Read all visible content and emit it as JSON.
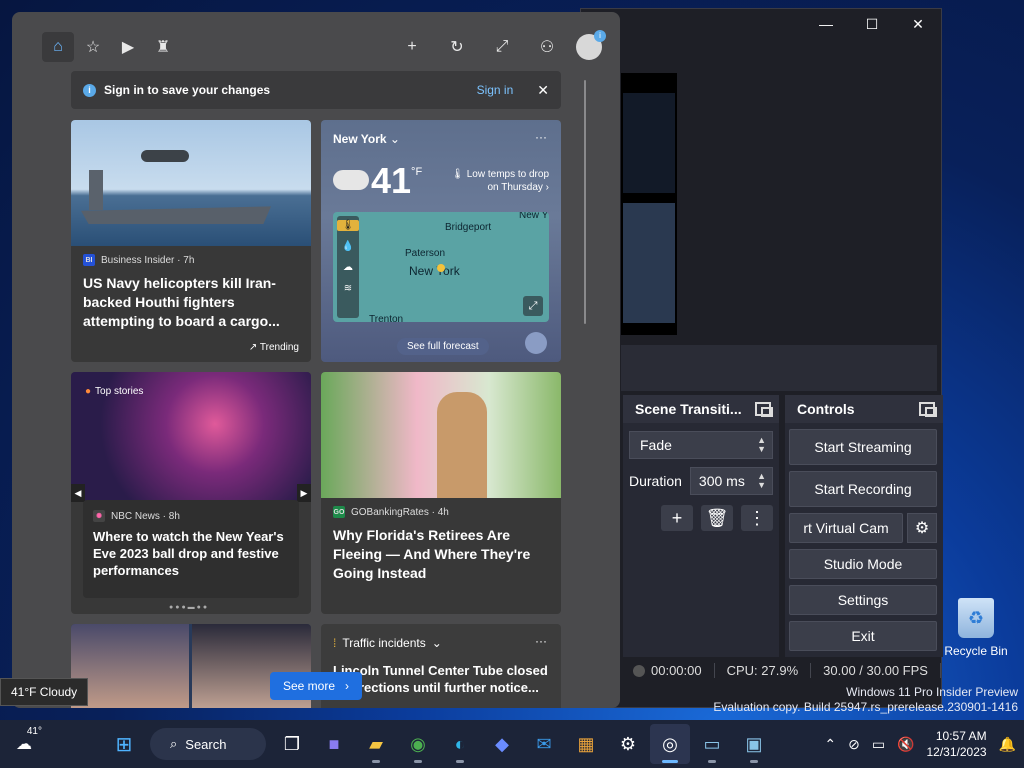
{
  "obs": {
    "window_controls": {
      "minimize": "—",
      "maximize": "☐",
      "close": "✕"
    },
    "scene_transitions": {
      "title": "Scene Transiti...",
      "transition": "Fade",
      "duration_label": "Duration",
      "duration_value": "300 ms",
      "add": "+",
      "remove": "🗑",
      "more": "⋮"
    },
    "controls": {
      "title": "Controls",
      "start_streaming": "Start Streaming",
      "start_recording": "Start Recording",
      "virtual_cam": "rt Virtual Cam",
      "studio_mode": "Studio Mode",
      "settings": "Settings",
      "exit": "Exit"
    },
    "status": {
      "rec_time": "00:00:00",
      "cpu": "CPU: 27.9%",
      "fps": "30.00 / 30.00 FPS"
    }
  },
  "watermark": {
    "line1": "Windows 11 Pro Insider Preview",
    "line2": "Evaluation copy. Build 25947.rs_prerelease.230901-1416"
  },
  "desktop": {
    "recycle_bin": "Recycle Bin"
  },
  "widgets": {
    "signin_bar": {
      "message": "Sign in to save your changes",
      "link": "Sign in"
    },
    "cards": {
      "navy": {
        "source": "Business Insider · 7h",
        "source_logo": "BI",
        "headline": "US Navy helicopters kill Iran-backed Houthi fighters attempting to board a cargo...",
        "trending": "Trending"
      },
      "weather": {
        "location": "New York",
        "temp": "41",
        "unit": "°F",
        "note": "Low temps to drop on Thursday",
        "map_labels": [
          "Bridgeport",
          "Paterson",
          "New York",
          "Trenton",
          "New Y"
        ],
        "see_forecast": "See full forecast"
      },
      "nye": {
        "tag": "Top stories",
        "source": "NBC News · 8h",
        "headline": "Where to watch the New Year's Eve 2023 ball drop and festive performances"
      },
      "florida": {
        "source": "GOBankingRates · 4h",
        "source_logo": "GO",
        "headline": "Why Florida's Retirees Are Fleeing — And Where They're Going Instead"
      },
      "traffic": {
        "tag": "Traffic incidents",
        "headline": "Lincoln Tunnel Center Tube closed ... directions until further notice..."
      }
    },
    "see_more": "See more",
    "tooltip": "41°F Cloudy"
  },
  "taskbar": {
    "weather_temp": "41°",
    "search_label": "Search",
    "time": "10:57 AM",
    "date": "12/31/2023"
  },
  "colors": {
    "accent": "#6cb8ff",
    "see_more_bg": "#1f6fe0",
    "obs_bg": "#1e1f26"
  }
}
